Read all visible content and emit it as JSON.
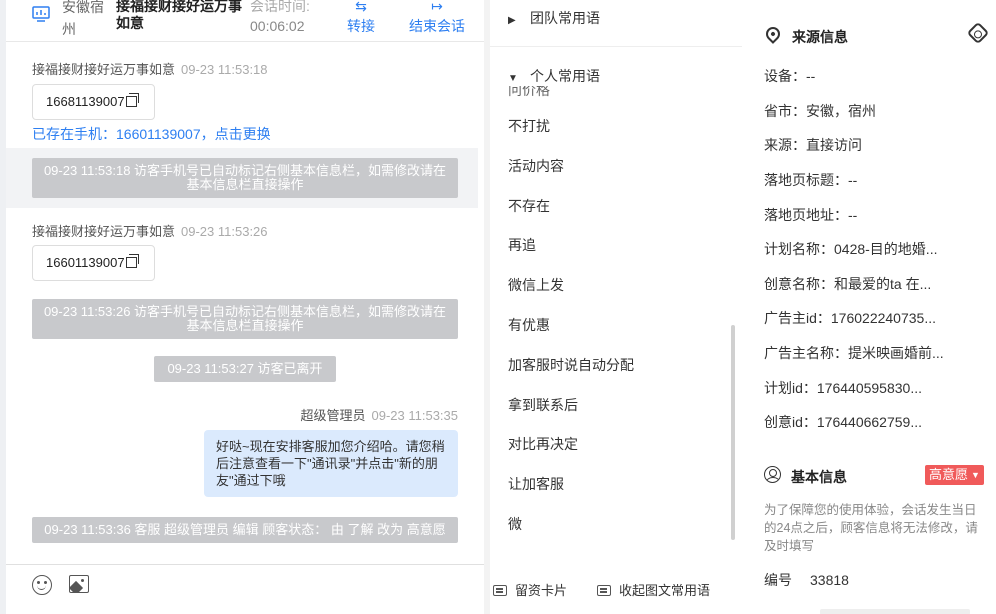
{
  "header": {
    "location": "安徽宿州",
    "visitor_name": "接福接财接好运万事如意",
    "session_time_label": "会话时间:",
    "session_time": "00:06:02",
    "transfer_label": "转接",
    "end_label": "结束会话"
  },
  "messages": {
    "m1": {
      "sender": "接福接财接好运万事如意",
      "time": "09-23 11:53:18",
      "phone": "16681139007"
    },
    "exists_tip": "已存在手机：16601139007，点击更换",
    "sys1": "09-23 11:53:18 访客手机号已自动标记右侧基本信息栏，如需修改请在基本信息栏直接操作",
    "m2": {
      "sender": "接福接财接好运万事如意",
      "time": "09-23 11:53:26",
      "phone": "16601139007"
    },
    "sys2": "09-23 11:53:26 访客手机号已自动标记右侧基本信息栏，如需修改请在基本信息栏直接操作",
    "sys3": "09-23 11:53:27 访客已离开",
    "m3": {
      "sender": "超级管理员",
      "time": "09-23 11:53:35",
      "text": "好哒~现在安排客服加您介绍哈。请您稍后注意查看一下\"通讯录\"并点击\"新的朋友\"通过下哦"
    },
    "sys4": "09-23 11:53:36 客服 超级管理员 编辑 顾客状态： 由 了解 改为 高意愿"
  },
  "phrases": {
    "team_group": "团队常用语",
    "personal_group": "个人常用语",
    "cutoff_item": "问价格",
    "items": [
      "不打扰",
      "活动内容",
      "不存在",
      "再追",
      "微信上发",
      "有优惠",
      "加客服时说自动分配",
      "拿到联系后",
      "对比再决定",
      "让加客服",
      "微"
    ],
    "footer_card": "留资卡片",
    "footer_collapse": "收起图文常用语"
  },
  "source_info": {
    "title": "来源信息",
    "rows": [
      "设备：--",
      "省市：安徽，宿州",
      "来源：直接访问",
      "落地页标题：--",
      "落地页地址：--",
      "计划名称：0428-目的地婚...",
      "创意名称：和最爱的ta 在...",
      "广告主id：176022240735...",
      "广告主名称：提米映画婚前...",
      "计划id：176440595830...",
      "创意id：176440662759..."
    ]
  },
  "basic_info": {
    "title": "基本信息",
    "intent_badge": "高意愿",
    "notice": "为了保障您的使用体验，会话发生当日的24点之后，顾客信息将无法修改，请及时填写",
    "number_label": "编号",
    "number_value": "33818"
  },
  "colors": {
    "accent": "#2e7ff1",
    "badge": "#f05a5a",
    "bubble": "#dbeafd",
    "system": "#c8c9cc"
  }
}
